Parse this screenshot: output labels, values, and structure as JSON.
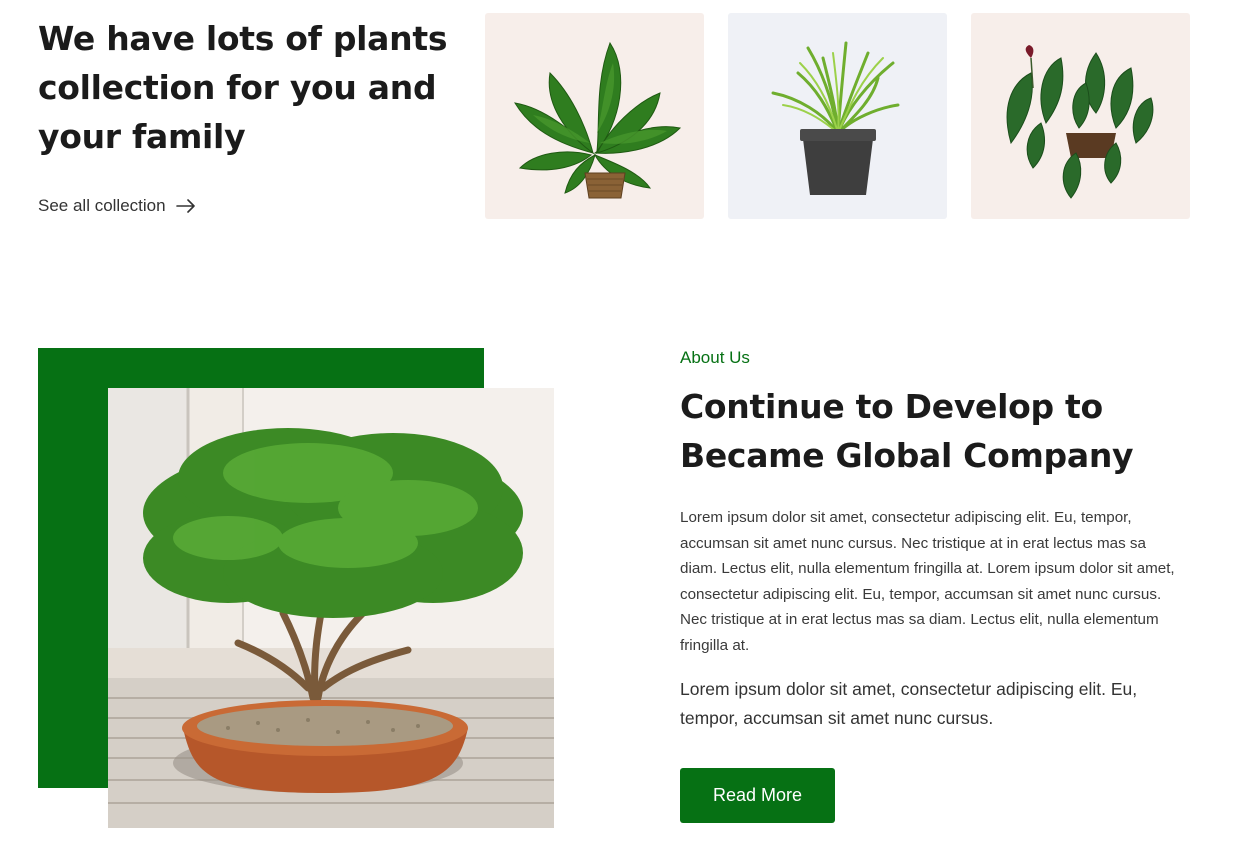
{
  "collection": {
    "heading": "We have lots of plants collection for you and your family",
    "see_all_label": "See all collection",
    "cards": [
      {
        "plant": "pothos-in-wicker-basket",
        "bg": "#f7eeea"
      },
      {
        "plant": "grass-in-black-pot",
        "bg": "#eff1f6"
      },
      {
        "plant": "anthurium-in-pot",
        "bg": "#f7eeea"
      }
    ]
  },
  "about": {
    "label": "About Us",
    "heading": "Continue to Develop to Became Global Company",
    "paragraph1": "Lorem ipsum dolor sit amet, consectetur adipiscing elit. Eu, tempor, accumsan sit amet nunc cursus. Nec tristique at in erat lectus mas sa diam. Lectus elit, nulla elementum fringilla at. Lorem ipsum dolor sit amet, consectetur adipiscing elit. Eu, tempor, accumsan sit amet nunc cursus. Nec tristique at in erat lectus mas sa diam. Lectus elit, nulla elementum fringilla at.",
    "paragraph2": "Lorem ipsum dolor sit amet, consectetur adipiscing elit. Eu, tempor, accumsan sit amet nunc cursus.",
    "button_label": "Read More",
    "image": "bonsai-tree-photo"
  },
  "colors": {
    "brand_green": "#067114",
    "heading_text": "#1b1b1b",
    "body_text": "#3a3a3a"
  }
}
